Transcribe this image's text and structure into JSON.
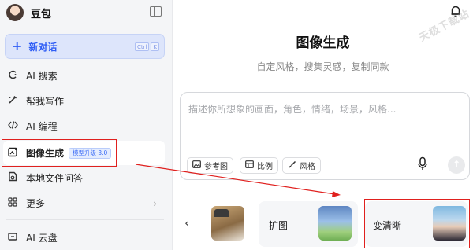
{
  "sidebar": {
    "app_name": "豆包",
    "new_chat_label": "新对话",
    "new_chat_shortcut": [
      "Ctrl",
      "K"
    ],
    "items": [
      {
        "label": "AI 搜索",
        "icon": "search-icon"
      },
      {
        "label": "帮我写作",
        "icon": "pen-icon"
      },
      {
        "label": "AI 编程",
        "icon": "code-icon"
      },
      {
        "label": "图像生成",
        "icon": "image-gen-icon",
        "badge": "模型升级 3.0",
        "active": true
      },
      {
        "label": "本地文件问答",
        "icon": "file-icon"
      },
      {
        "label": "更多",
        "icon": "grid-icon"
      },
      {
        "label": "AI 云盘",
        "icon": "cloud-drive-icon"
      }
    ]
  },
  "main": {
    "title": "图像生成",
    "subtitle": "自定风格，搜集灵感，复制同款",
    "prompt_placeholder": "描述你所想象的画面，角色，情绪，场景，风格...",
    "chips": {
      "reference": "参考图",
      "ratio": "比例",
      "style": "风格"
    },
    "cards": {
      "expand": "扩图",
      "sharpen": "变清晰"
    },
    "watermark": "天极下载站"
  },
  "colors": {
    "accent": "#2f5df5",
    "highlight_border": "#e0201e",
    "sidebar_bg": "#f4f5f7"
  }
}
